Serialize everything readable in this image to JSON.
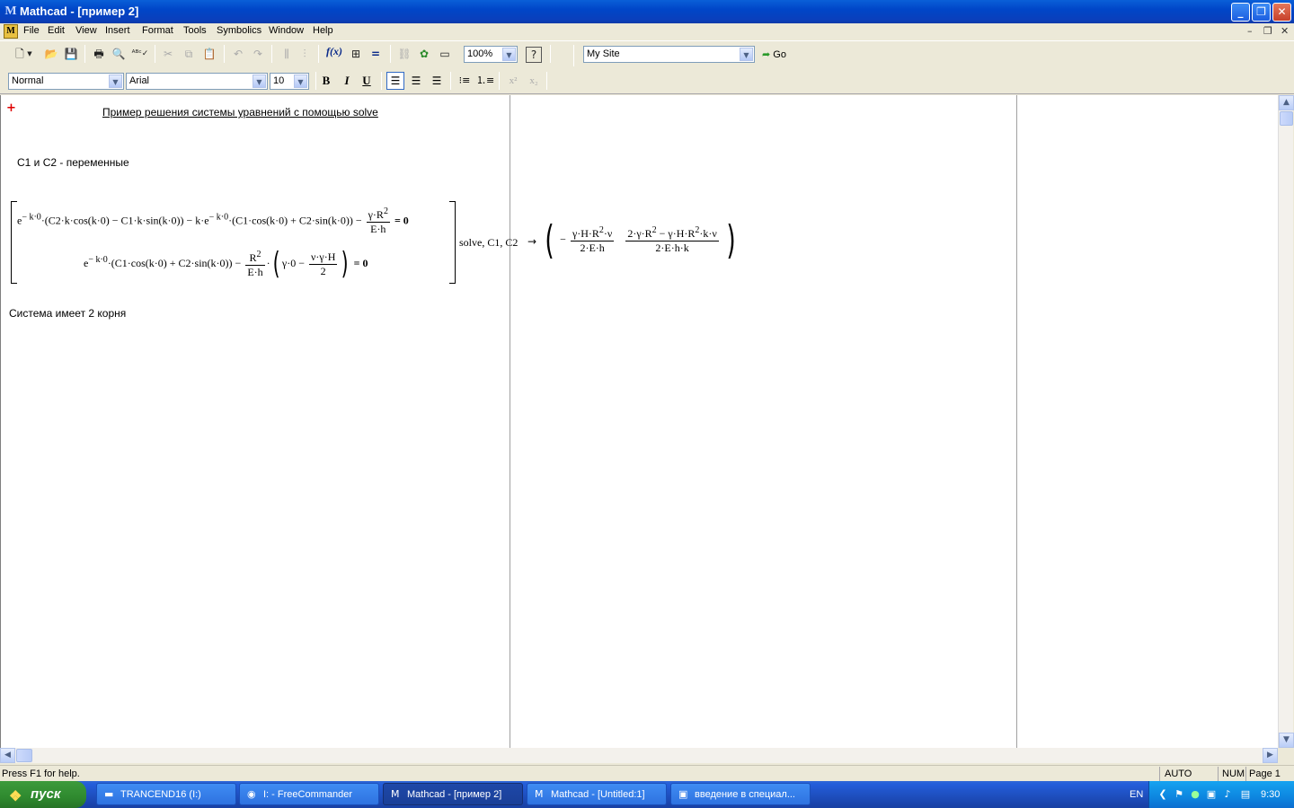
{
  "window": {
    "title": "Mathcad - [пример 2]",
    "app_icon": "mathcad-logo-icon",
    "controls": [
      "minimize-icon",
      "restore-icon",
      "close-icon"
    ]
  },
  "menu": {
    "items": [
      "File",
      "Edit",
      "View",
      "Insert",
      "Format",
      "Tools",
      "Symbolics",
      "Window",
      "Help"
    ]
  },
  "toolbar": {
    "zoom": "100%",
    "site": "My Site",
    "go_label": "Go"
  },
  "format_bar": {
    "style": "Normal",
    "font": "Arial",
    "size": "10",
    "bold": "B",
    "italic": "I",
    "underline": "U"
  },
  "worksheet": {
    "heading": "Пример решения системы уравнений с помощью solve",
    "vars_note": "C1 и C2 - переменные",
    "eq1": {
      "e": "e",
      "exp": "− k·0",
      "body": "·(C2·k·cos(k·0) − C1·k·sin(k·0)) − k·e",
      "exp2": "− k·0",
      "body2": "·(C1·cos(k·0) + C2·sin(k·0)) −",
      "frac_num": "γ·R",
      "frac_num_sup": "2",
      "frac_den": "E·h",
      "rel": "= 0"
    },
    "eq2": {
      "e": "e",
      "exp": "− k·0",
      "body": "·(C1·cos(k·0) + C2·sin(k·0)) −",
      "frac_num": "R",
      "frac_num_sup": "2",
      "frac_den": "E·h",
      "inner_a": "γ·0 −",
      "inner_num": "ν·γ·H",
      "inner_den": "2",
      "rel": "= 0"
    },
    "solve_label": "solve, C1, C2",
    "arrow": "→",
    "res1": {
      "sign": "−",
      "num": "γ·H·R",
      "num_sup": "2",
      "num_tail": "·ν",
      "den": "2·E·h"
    },
    "res2": {
      "num_a": "2·γ·R",
      "num_sup_a": "2",
      "num_mid": " − γ·H·R",
      "num_sup_b": "2",
      "num_tail": "·k·ν",
      "den": "2·E·h·k"
    },
    "conclusion": "Система имеет 2 корня"
  },
  "status": {
    "help": "Press F1 for help.",
    "mode": "AUTO",
    "num": "NUM",
    "page": "Page 1"
  },
  "taskbar": {
    "start": "пуск",
    "tasks": [
      {
        "label": "TRANCEND16 (I:)",
        "icon": "drive-icon"
      },
      {
        "label": "I: - FreeCommander",
        "icon": "freecommander-icon"
      },
      {
        "label": "Mathcad - [пример 2]",
        "icon": "mathcad-icon"
      },
      {
        "label": "Mathcad - [Untitled:1]",
        "icon": "mathcad-icon"
      },
      {
        "label": "введение в специал...",
        "icon": "word-doc-icon"
      }
    ],
    "lang": "EN",
    "clock": "9:30"
  }
}
